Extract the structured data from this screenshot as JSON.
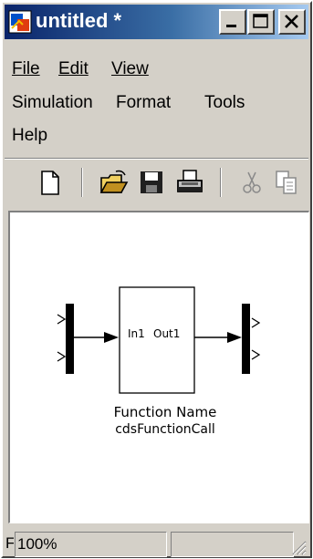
{
  "window": {
    "title": "untitled *",
    "buttons": {
      "minimize": "minimize",
      "maximize": "maximize",
      "close": "close"
    }
  },
  "menu": {
    "file": "File",
    "edit": "Edit",
    "view": "View",
    "simulation": "Simulation",
    "format": "Format",
    "tools": "Tools",
    "help": "Help"
  },
  "toolbar": {
    "items": [
      "new-icon",
      "open-icon",
      "save-icon",
      "print-icon",
      "cut-icon",
      "copy-icon"
    ]
  },
  "canvas": {
    "block": {
      "port_in": "In1",
      "port_out": "Out1",
      "label_line1": "Function Name",
      "label_line2": "cdsFunctionCall"
    }
  },
  "status": {
    "left": "F",
    "zoom": "100%",
    "right": ""
  },
  "colors": {
    "title_active": "#0a246a",
    "face": "#d4d0c8",
    "canvas": "#ffffff"
  }
}
